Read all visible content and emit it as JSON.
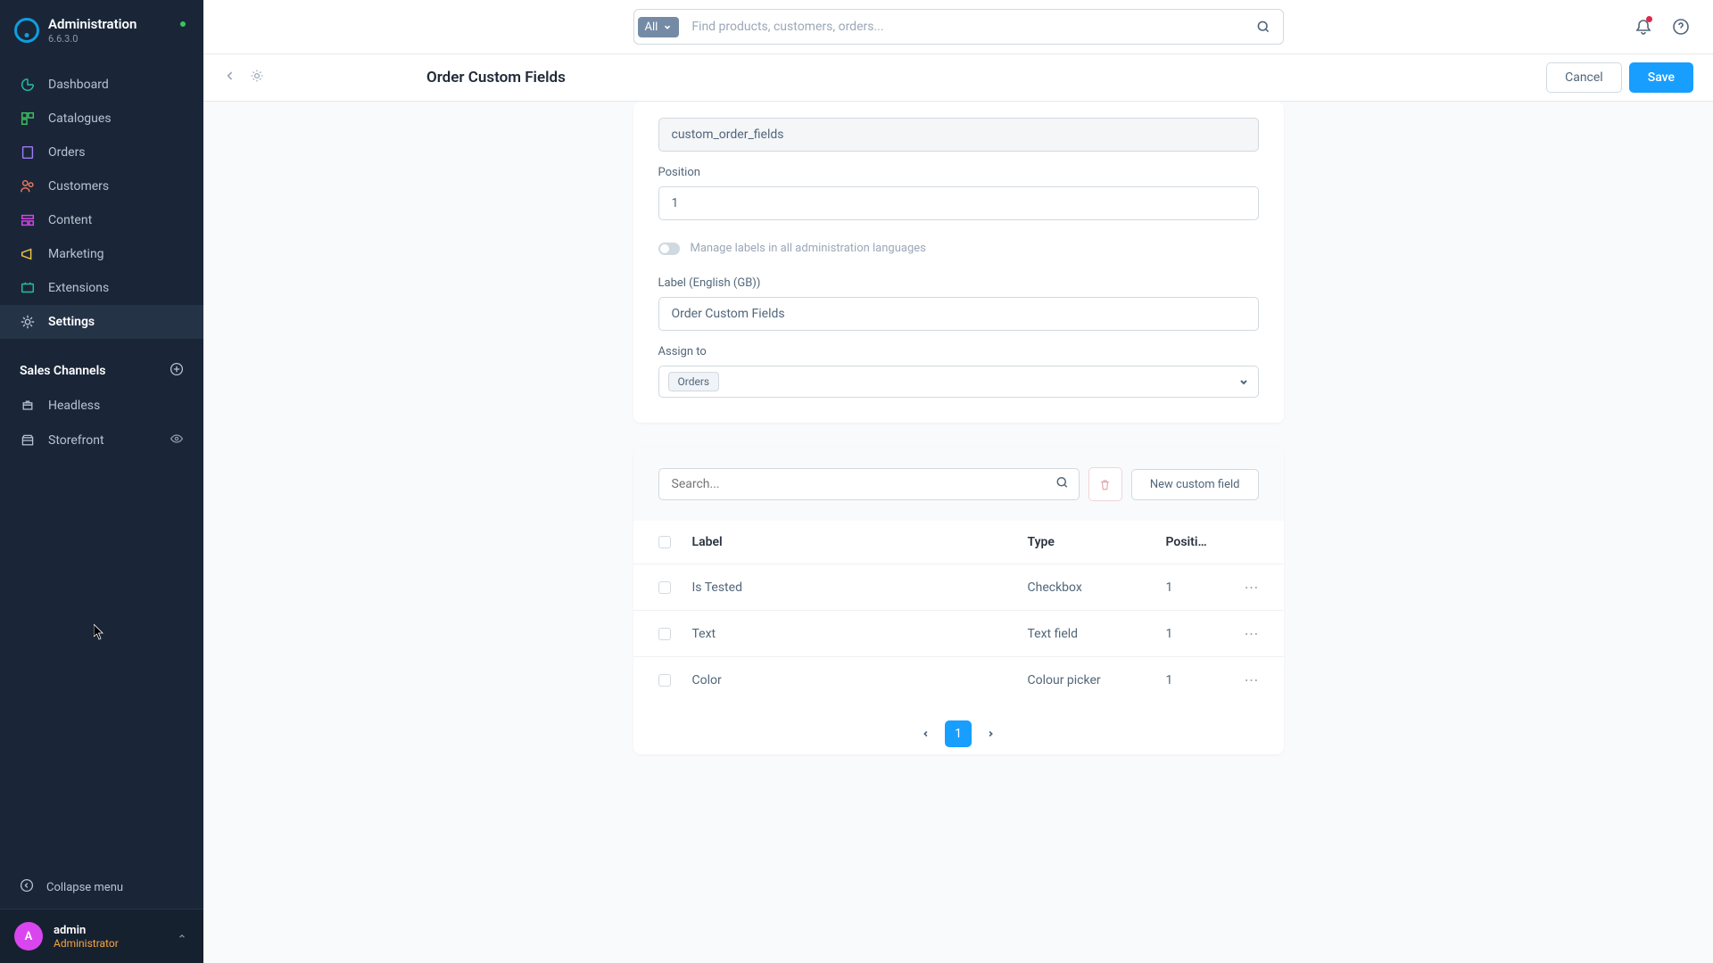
{
  "app": {
    "title": "Administration",
    "version": "6.6.3.0"
  },
  "nav": [
    {
      "label": "Dashboard",
      "icon": "dashboard",
      "color": "#21c0a8"
    },
    {
      "label": "Catalogues",
      "icon": "catalogue",
      "color": "#3cc261"
    },
    {
      "label": "Orders",
      "icon": "orders",
      "color": "#9e7cf2"
    },
    {
      "label": "Customers",
      "icon": "customers",
      "color": "#f27a5e"
    },
    {
      "label": "Content",
      "icon": "content",
      "color": "#d946ef"
    },
    {
      "label": "Marketing",
      "icon": "marketing",
      "color": "#f5c642"
    },
    {
      "label": "Extensions",
      "icon": "extensions",
      "color": "#21c0a8"
    },
    {
      "label": "Settings",
      "icon": "settings",
      "color": "#b8c2d0",
      "active": true
    }
  ],
  "salesChannels": {
    "title": "Sales Channels",
    "items": [
      {
        "label": "Headless"
      },
      {
        "label": "Storefront",
        "visible_icon": true
      }
    ]
  },
  "collapse_label": "Collapse menu",
  "user": {
    "initial": "A",
    "name": "admin",
    "role": "Administrator"
  },
  "search": {
    "filter": "All",
    "placeholder": "Find products, customers, orders..."
  },
  "page": {
    "title": "Order Custom Fields",
    "cancel": "Cancel",
    "save": "Save"
  },
  "form": {
    "technical_name_value": "custom_order_fields",
    "position_label": "Position",
    "position_value": "1",
    "toggle_label": "Manage labels in all administration languages",
    "label_label": "Label (English (GB))",
    "label_value": "Order Custom Fields",
    "assign_label": "Assign to",
    "assign_tag": "Orders"
  },
  "fields": {
    "search_placeholder": "Search...",
    "new_button": "New custom field",
    "columns": {
      "label": "Label",
      "type": "Type",
      "position": "Positi…"
    },
    "rows": [
      {
        "label": "Is Tested",
        "type": "Checkbox",
        "position": "1"
      },
      {
        "label": "Text",
        "type": "Text field",
        "position": "1"
      },
      {
        "label": "Color",
        "type": "Colour picker",
        "position": "1"
      }
    ],
    "current_page": "1"
  }
}
